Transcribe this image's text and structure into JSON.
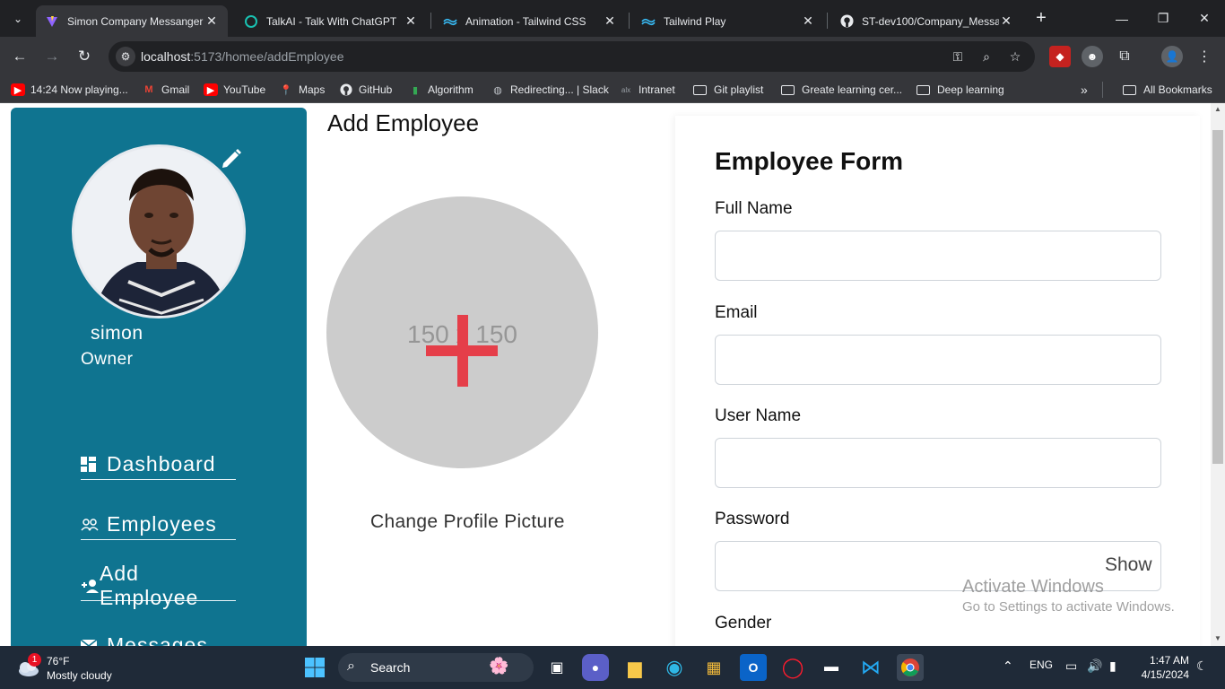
{
  "browser": {
    "tabs": [
      {
        "title": "Simon Company Messanger",
        "active": true
      },
      {
        "title": "TalkAI - Talk With ChatGPT",
        "active": false
      },
      {
        "title": "Animation - Tailwind CSS",
        "active": false
      },
      {
        "title": "Tailwind Play",
        "active": false
      },
      {
        "title": "ST-dev100/Company_Messa",
        "active": false
      }
    ],
    "url_host": "localhost",
    "url_path": ":5173/homee/addEmployee",
    "bookmarks": [
      "14:24 Now playing...",
      "Gmail",
      "YouTube",
      "Maps",
      "GitHub",
      "Algorithm",
      "Redirecting... | Slack",
      "Intranet",
      "Git playlist",
      "Greate learning cer...",
      "Deep learning",
      "All Bookmarks"
    ],
    "colors": {
      "tabstrip": "#202124",
      "toolbar": "#35363a"
    }
  },
  "sidebar": {
    "user_name": "simon",
    "user_role": "Owner",
    "nav": [
      {
        "label": "Dashboard",
        "icon": "dashboard-icon"
      },
      {
        "label": "Employees",
        "icon": "people-icon"
      },
      {
        "label": "Add Employee",
        "icon": "add-person-icon"
      },
      {
        "label": "Messages",
        "icon": "mail-icon"
      }
    ],
    "color": "#0f7490"
  },
  "main": {
    "title": "Add Employee",
    "placeholder_text": "150 x 150",
    "change_picture": "Change Profile Picture"
  },
  "form": {
    "title": "Employee Form",
    "fields": [
      {
        "label": "Full Name",
        "value": ""
      },
      {
        "label": "Email",
        "value": ""
      },
      {
        "label": "User Name",
        "value": ""
      },
      {
        "label": "Password",
        "value": ""
      }
    ],
    "gender_label": "Gender",
    "show_label": "Show"
  },
  "watermark": {
    "line1": "Activate Windows",
    "line2": "Go to Settings to activate Windows."
  },
  "taskbar": {
    "weather_badge": "1",
    "temp": "76°F",
    "condition": "Mostly cloudy",
    "search": "Search",
    "lang": "ENG",
    "time": "1:47 AM",
    "date": "4/15/2024"
  }
}
